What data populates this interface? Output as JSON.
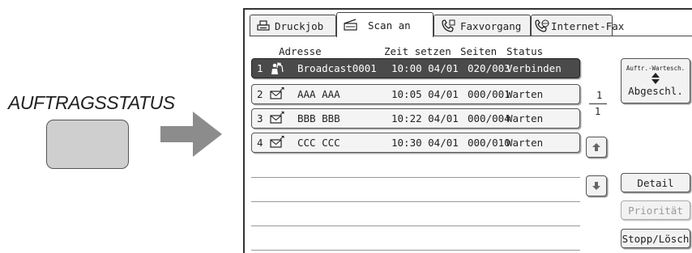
{
  "panel": {
    "key_label": "AUFTRAGSSTATUS"
  },
  "tabs": [
    {
      "label": "Druckjob",
      "icon": "printer-icon"
    },
    {
      "label": "Scan an",
      "icon": "scanner-icon"
    },
    {
      "label": "Faxvorgang",
      "icon": "fax-phone-icon"
    },
    {
      "label": "Internet-Fax",
      "icon": "internet-fax-icon"
    }
  ],
  "columns": {
    "address": "Adresse",
    "time": "Zeit setzen",
    "pages": "Seiten",
    "status": "Status"
  },
  "jobs": [
    {
      "num": "1",
      "icon": "broadcast-icon",
      "address": "Broadcast0001",
      "time": "10:00 04/01",
      "pages": "020/003",
      "status": "Verbinden"
    },
    {
      "num": "2",
      "icon": "email-icon",
      "address": "AAA AAA",
      "time": "10:05 04/01",
      "pages": "000/001",
      "status": "Warten"
    },
    {
      "num": "3",
      "icon": "email-icon",
      "address": "BBB BBB",
      "time": "10:22 04/01",
      "pages": "000/004",
      "status": "Warten"
    },
    {
      "num": "4",
      "icon": "email-icon",
      "address": "CCC CCC",
      "time": "10:30 04/01",
      "pages": "000/010",
      "status": "Warten"
    }
  ],
  "pagination": {
    "current": "1",
    "total": "1"
  },
  "buttons": {
    "toggle_small": "Auftr.-Wartesch.",
    "toggle_main": "Abgeschl.",
    "detail": "Detail",
    "priority": "Priorität",
    "stop_delete": "Stopp/Lösch"
  },
  "colors": {
    "selected_row": "#4a4a4a",
    "key_fill": "#cfcfcf",
    "arrow": "#8c8c8c"
  }
}
